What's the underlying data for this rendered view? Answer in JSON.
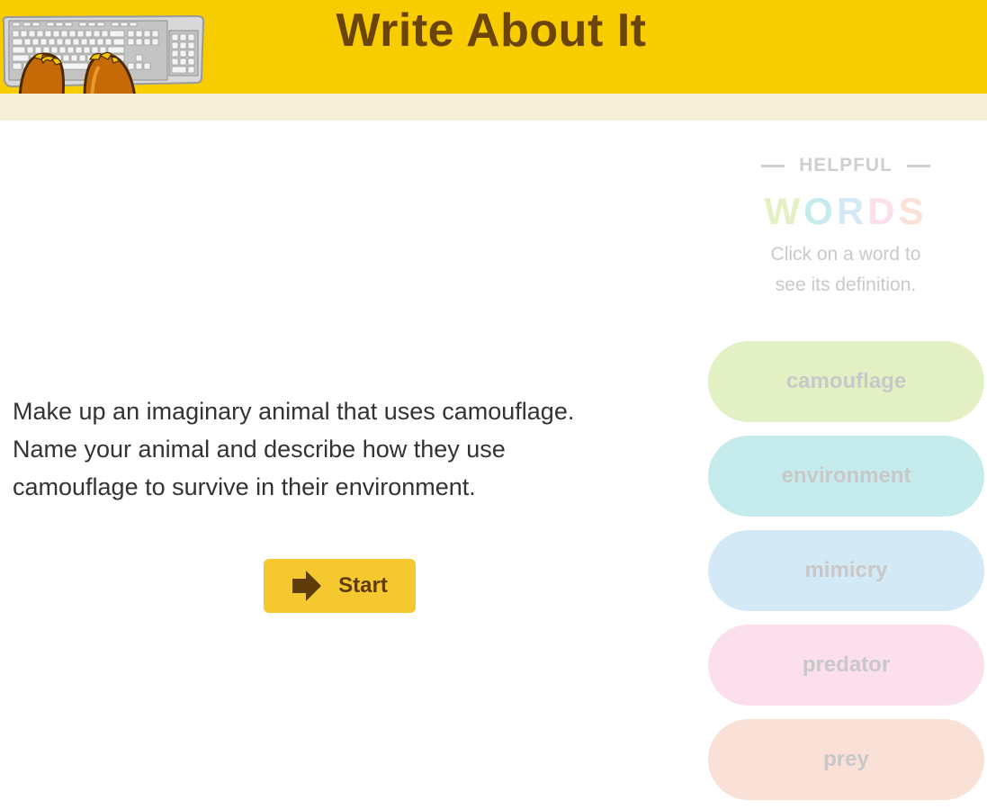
{
  "header": {
    "title": "Write About It"
  },
  "prompt": {
    "line1": "Make up an imaginary animal that uses camouflage.",
    "line2": "Name your animal and describe how they use",
    "line3": "camouflage to survive in their environment."
  },
  "start_button": {
    "label": "Start",
    "icon": "arrow-right-icon"
  },
  "helpful_words": {
    "heading": "HELPFUL",
    "words_title": [
      "W",
      "O",
      "R",
      "D",
      "S"
    ],
    "words_title_colors": [
      "#e2f0c3",
      "#c6ebec",
      "#d3e9f5",
      "#fbdfec",
      "#f9e1d8"
    ],
    "help_line1": "Click on a word to",
    "help_line2": "see its definition.",
    "items": [
      {
        "label": "camouflage",
        "color": "#e2f0c3"
      },
      {
        "label": "environment",
        "color": "#c6ebec"
      },
      {
        "label": "mimicry",
        "color": "#d3e9f5"
      },
      {
        "label": "predator",
        "color": "#fbdfec"
      },
      {
        "label": "prey",
        "color": "#f9e1d8"
      }
    ]
  },
  "colors": {
    "header_bg": "#f7cd00",
    "subbar_bg": "#f7eed8",
    "title_text": "#6b4409",
    "start_button_bg": "#f6c830"
  }
}
